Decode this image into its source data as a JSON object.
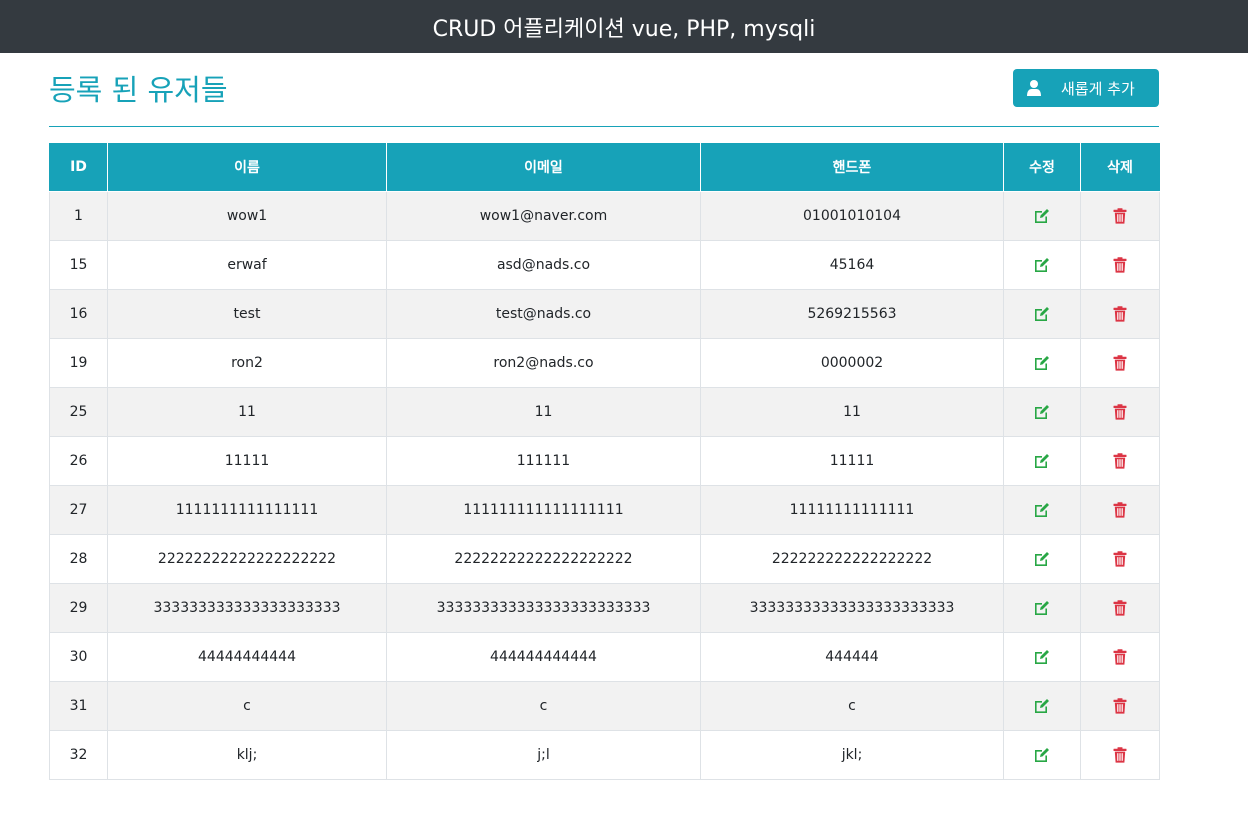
{
  "app": {
    "title": "CRUD 어플리케이션 vue, PHP, mysqli"
  },
  "page": {
    "title": "등록 된 유저들",
    "add_button_label": "새롭게 추가",
    "add_button_icon": "user-icon"
  },
  "colors": {
    "navbar": "#343a40",
    "accent": "#17a2b8",
    "edit": "#28a745",
    "delete": "#dc3545"
  },
  "table": {
    "headers": {
      "id": "ID",
      "name": "이름",
      "email": "이메일",
      "phone": "핸드폰",
      "edit": "수정",
      "delete": "삭제"
    },
    "edit_icon": "edit-icon",
    "delete_icon": "trash-icon",
    "rows": [
      {
        "id": "1",
        "name": "wow1",
        "email": "wow1@naver.com",
        "phone": "01001010104"
      },
      {
        "id": "15",
        "name": "erwaf",
        "email": "asd@nads.co",
        "phone": "45164"
      },
      {
        "id": "16",
        "name": "test",
        "email": "test@nads.co",
        "phone": "5269215563"
      },
      {
        "id": "19",
        "name": "ron2",
        "email": "ron2@nads.co",
        "phone": "0000002"
      },
      {
        "id": "25",
        "name": "11",
        "email": "11",
        "phone": "11"
      },
      {
        "id": "26",
        "name": "11111",
        "email": "111111",
        "phone": "11111"
      },
      {
        "id": "27",
        "name": "1111111111111111",
        "email": "111111111111111111",
        "phone": "11111111111111"
      },
      {
        "id": "28",
        "name": "22222222222222222222",
        "email": "22222222222222222222",
        "phone": "222222222222222222"
      },
      {
        "id": "29",
        "name": "333333333333333333333",
        "email": "333333333333333333333333",
        "phone": "33333333333333333333333"
      },
      {
        "id": "30",
        "name": "44444444444",
        "email": "444444444444",
        "phone": "444444"
      },
      {
        "id": "31",
        "name": "c",
        "email": "c",
        "phone": "c"
      },
      {
        "id": "32",
        "name": "klj;",
        "email": "j;l",
        "phone": "jkl;"
      }
    ]
  }
}
